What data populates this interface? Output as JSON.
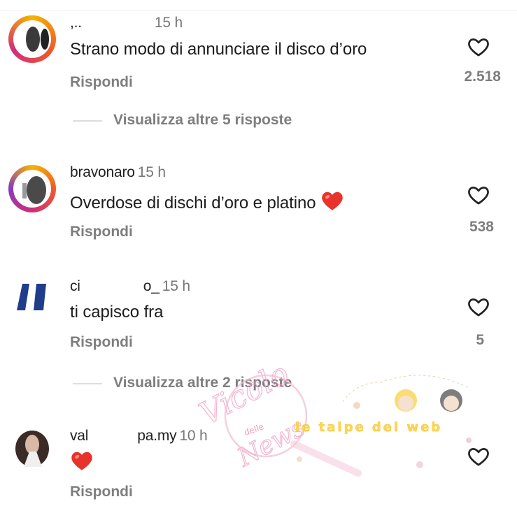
{
  "comments": [
    {
      "username": ",..",
      "time": "15 h",
      "text": "Strano modo di annunciare il disco d’oro",
      "reply_label": "Rispondi",
      "likes": "2.518",
      "view_replies": "Visualizza altre 5 risposte"
    },
    {
      "username": "bravonaro",
      "time": "15 h",
      "text": "Overdose di dischi d’oro e platino",
      "reply_label": "Rispondi",
      "likes": "538"
    },
    {
      "username": "ci",
      "username_end": "o_",
      "time": "15 h",
      "text": "ti capisco fra",
      "reply_label": "Rispondi",
      "likes": "5",
      "view_replies": "Visualizza altre 2 risposte"
    },
    {
      "username": "val",
      "username_end": "pa.my",
      "time": "10 h",
      "reply_label": "Rispondi"
    }
  ],
  "watermarks": {
    "vicolo": "Vicolo",
    "delle": "delle",
    "news": "News",
    "talpe": "le talpe del web"
  },
  "colors": {
    "like_heart_outline": "#222222",
    "emoji_heart": "#e8322c",
    "meta_text": "#7e7e7e"
  },
  "icons": {
    "like": "heart-outline-icon",
    "emoji": "red-heart-emoji"
  }
}
